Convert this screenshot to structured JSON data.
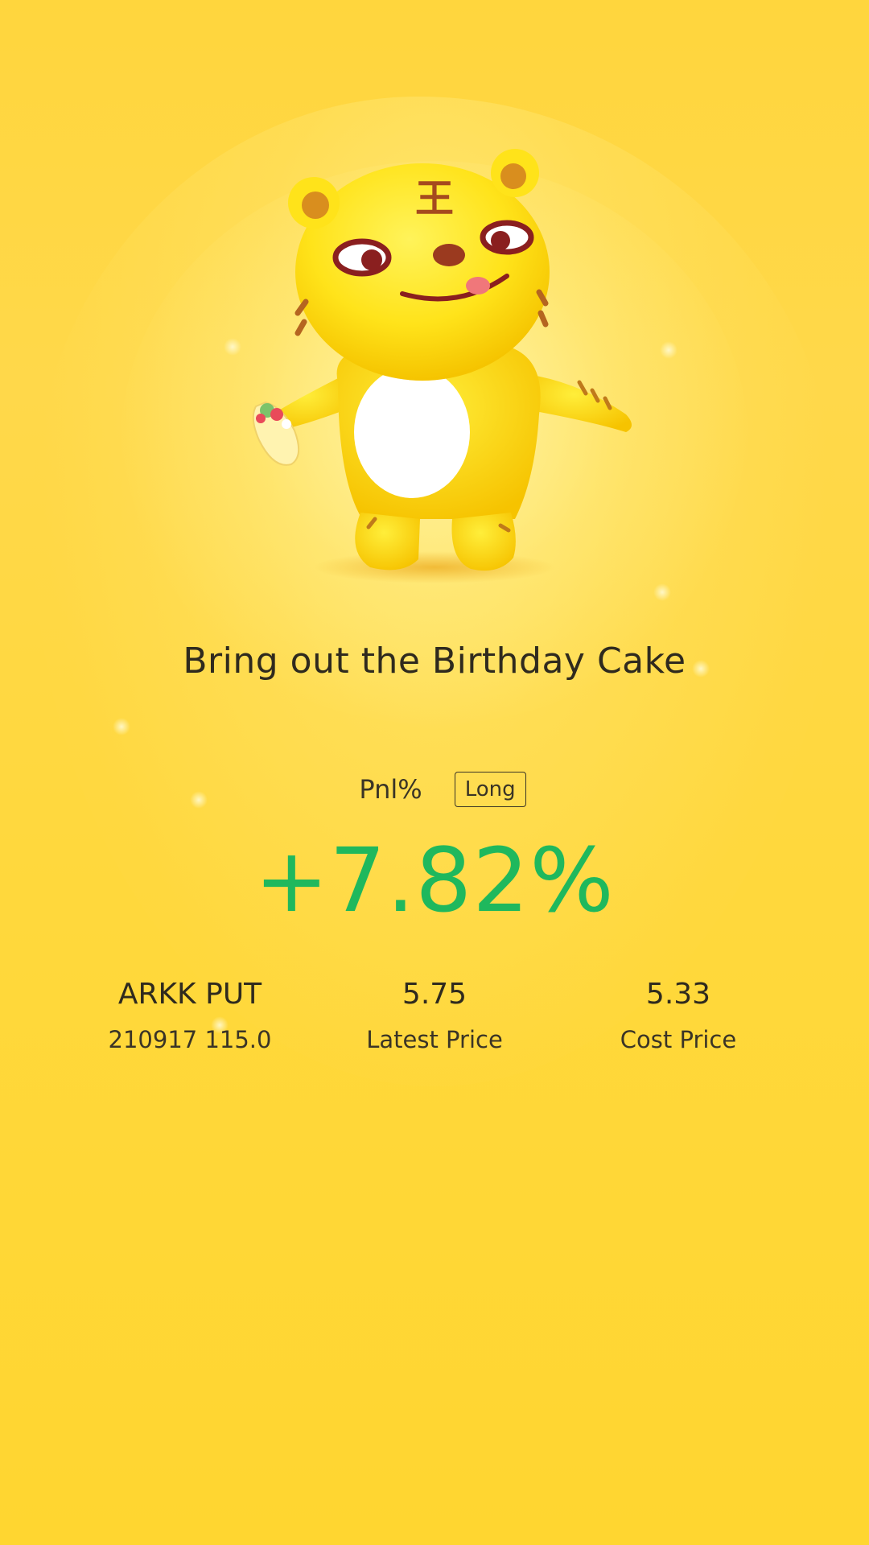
{
  "caption": "Bring out the Birthday Cake",
  "pnl": {
    "label": "Pnl%",
    "direction": "Long",
    "value": "+7.82%",
    "value_color": "#1fb85d"
  },
  "stats": {
    "symbol": "ARKK PUT",
    "contract": "210917 115.0",
    "latest_price": "5.75",
    "latest_price_label": "Latest Price",
    "cost_price": "5.33",
    "cost_price_label": "Cost Price"
  },
  "mascot": {
    "icon": "tiger-mascot-icon",
    "forehead_glyph": "王"
  },
  "colors": {
    "background": "#ffd63d",
    "text": "#2f2a1e",
    "positive": "#1fb85d"
  }
}
